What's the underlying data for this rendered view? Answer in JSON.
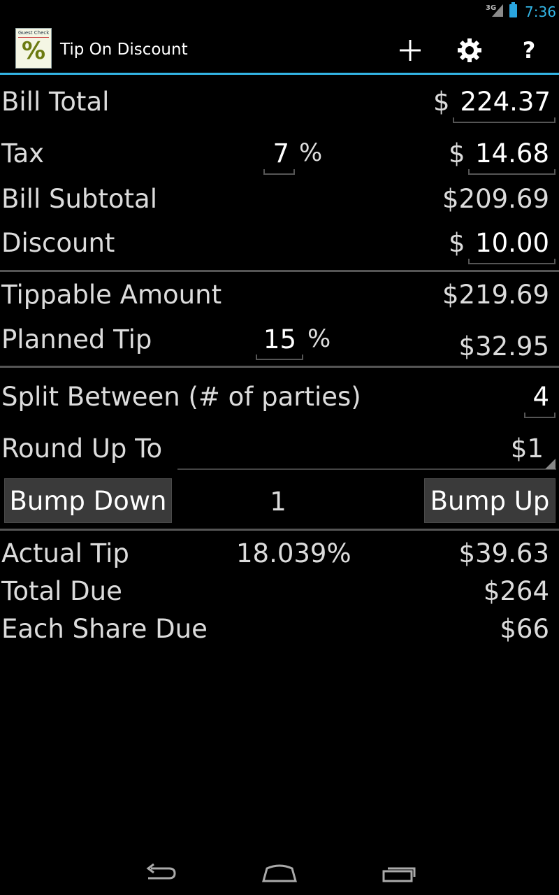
{
  "status_bar": {
    "network": "3G",
    "time": "7:36"
  },
  "app": {
    "title": "Tip On Discount",
    "icon_text": "Guest Check",
    "icon_symbol": "%"
  },
  "action_bar": {
    "add_icon": "plus-icon",
    "settings_icon": "gear-icon",
    "help_icon": "?"
  },
  "bill_total": {
    "label": "Bill Total",
    "currency": "$",
    "value": "224.37"
  },
  "tax": {
    "label": "Tax",
    "percent": "7",
    "percent_sign": "%",
    "currency": "$",
    "value": "14.68"
  },
  "bill_subtotal": {
    "label": "Bill Subtotal",
    "value": "$209.69"
  },
  "discount": {
    "label": "Discount",
    "currency": "$",
    "value": "10.00"
  },
  "tippable_amount": {
    "label": "Tippable Amount",
    "value": "$219.69"
  },
  "planned_tip": {
    "label": "Planned Tip",
    "percent": "15",
    "percent_sign": "%",
    "value": "$32.95"
  },
  "split": {
    "label": "Split Between (# of parties)",
    "value": "4"
  },
  "round_up": {
    "label": "Round Up To",
    "selected": "$1"
  },
  "bump": {
    "down_label": "Bump Down",
    "count": "1",
    "up_label": "Bump Up"
  },
  "actual_tip": {
    "label": "Actual Tip",
    "percent": "18.039%",
    "value": "$39.63"
  },
  "total_due": {
    "label": "Total Due",
    "value": "$264"
  },
  "each_share": {
    "label": "Each Share Due",
    "value": "$66"
  },
  "nav": {
    "back_icon": "back-icon",
    "home_icon": "home-icon",
    "recents_icon": "recents-icon"
  },
  "colors": {
    "accent": "#33b5e5",
    "background": "#000000",
    "button": "#3a3a3a"
  }
}
